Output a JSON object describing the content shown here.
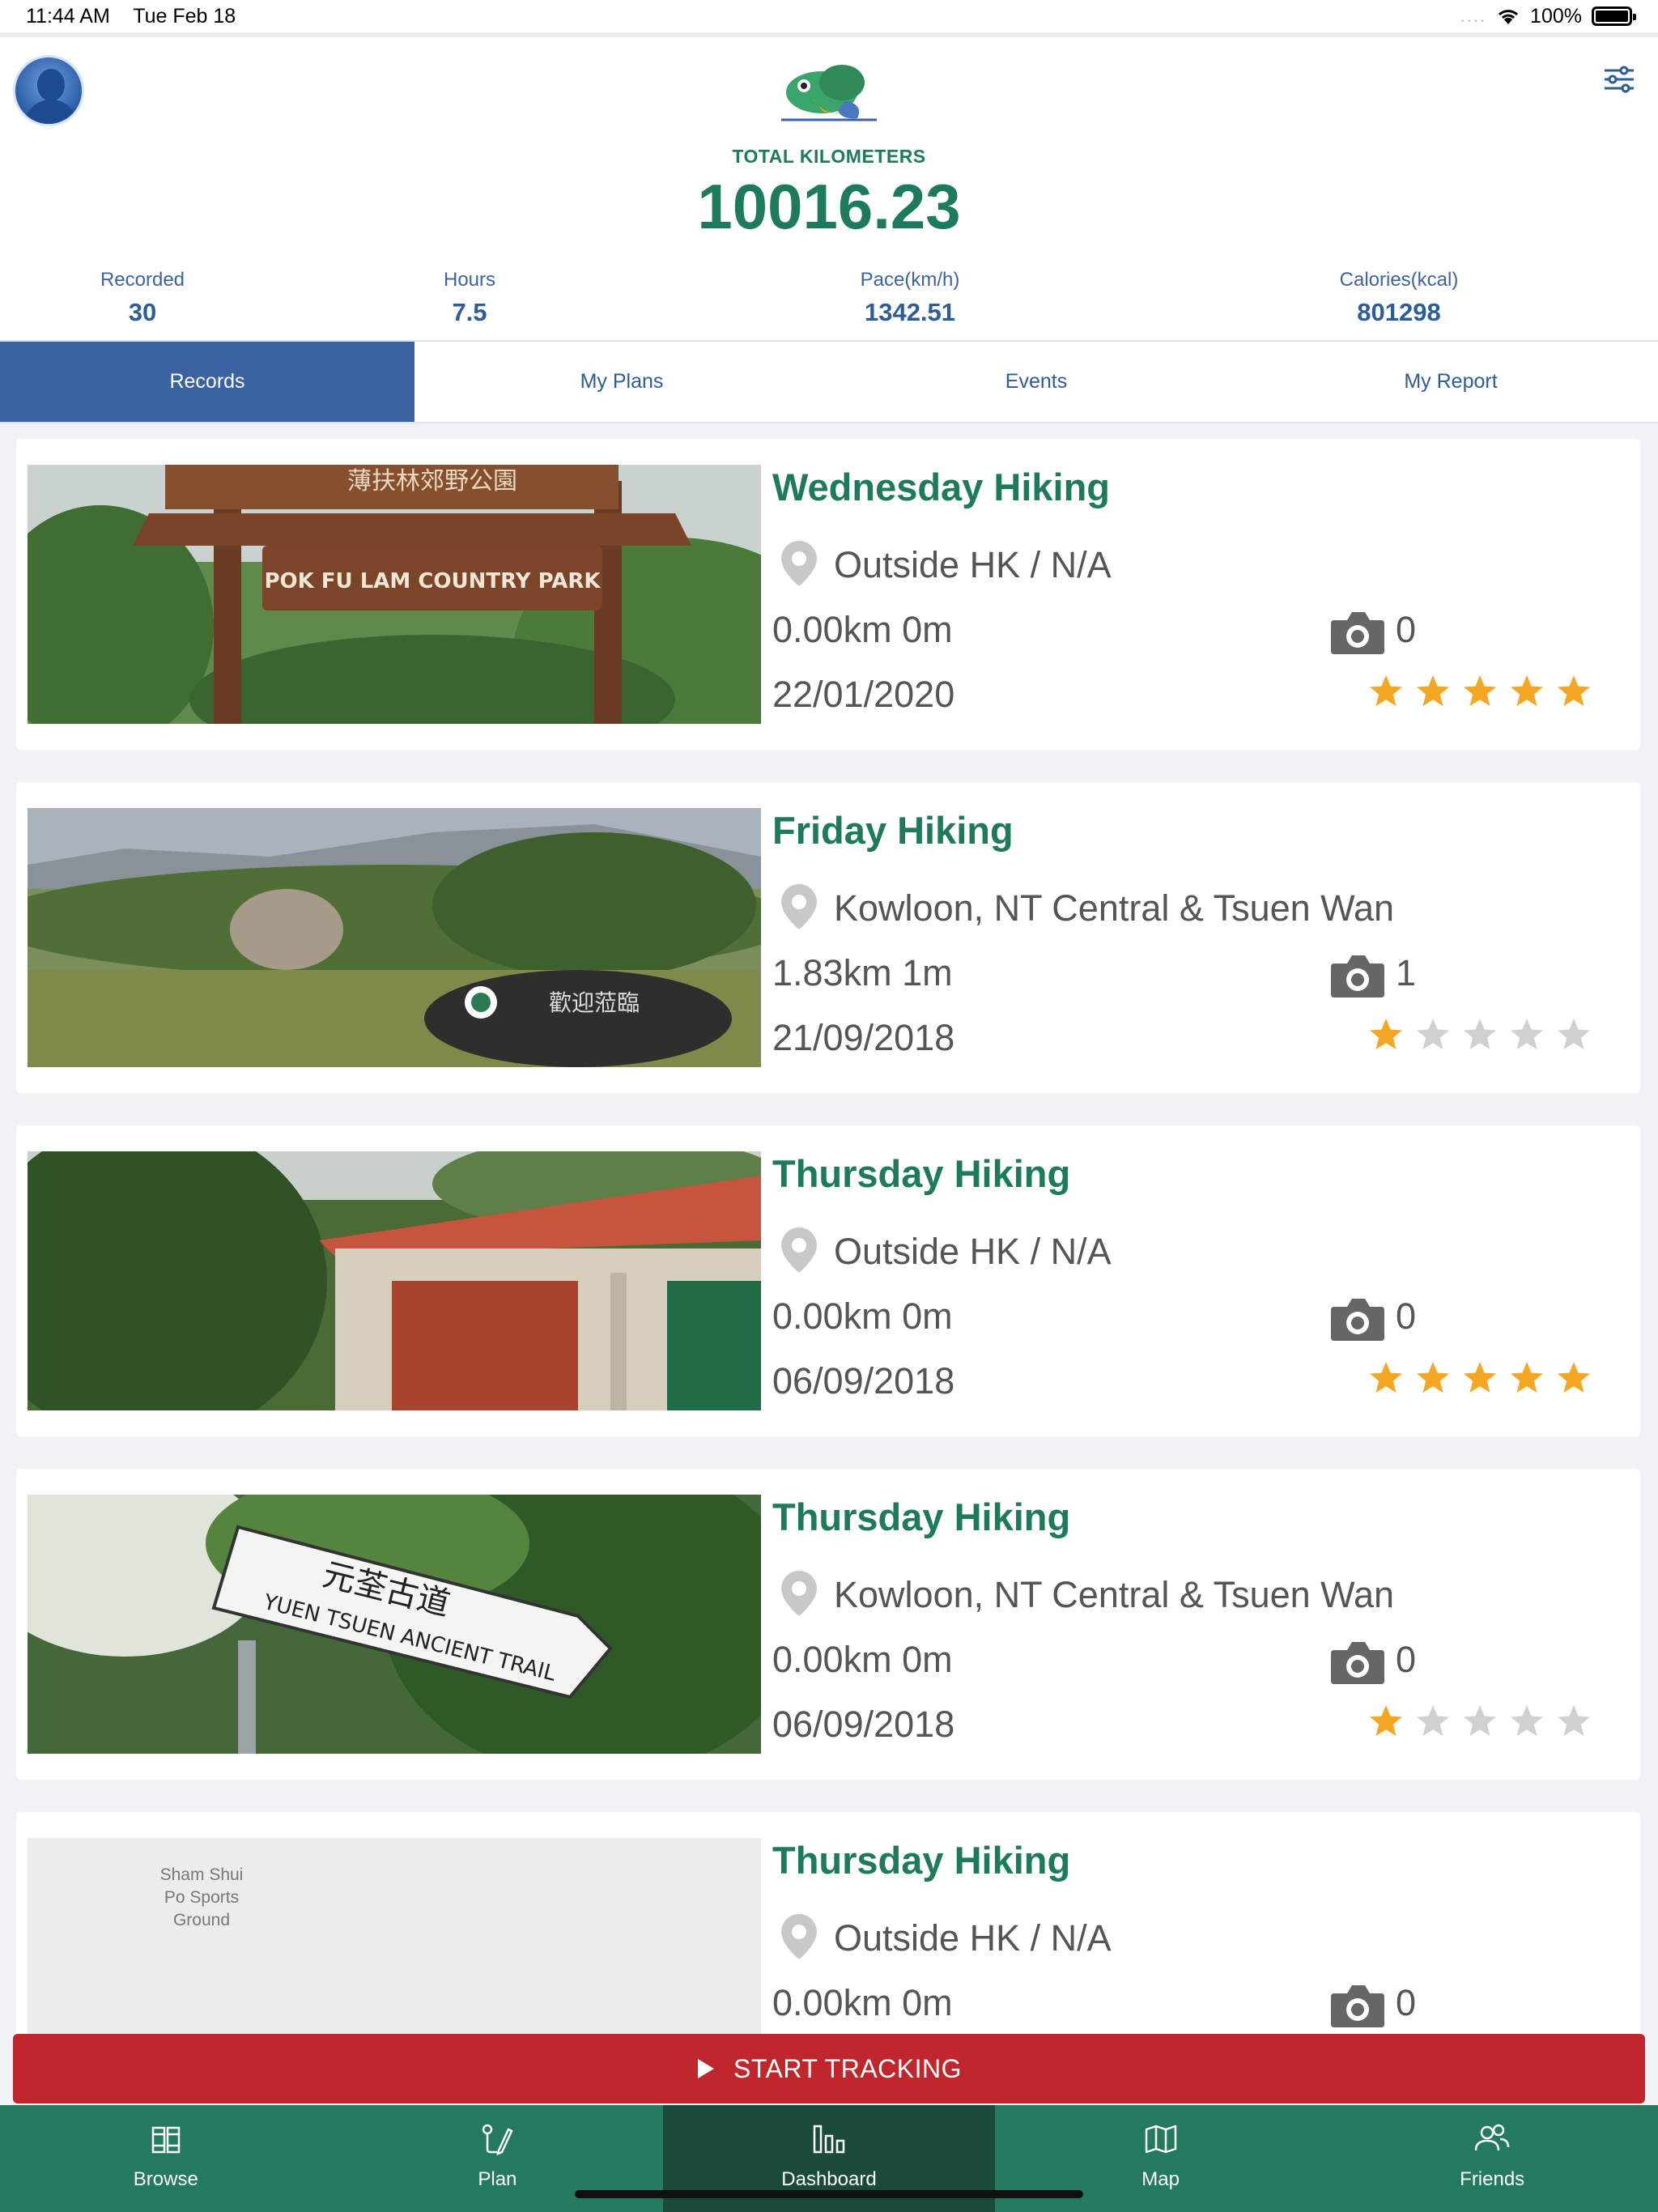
{
  "status_bar": {
    "time": "11:44 AM",
    "date": "Tue Feb 18",
    "battery": "100%"
  },
  "header": {
    "total_label": "TOTAL KILOMETERS",
    "total_value": "10016.23",
    "stats": [
      {
        "label": "Recorded",
        "value": "30"
      },
      {
        "label": "Hours",
        "value": "7.5"
      },
      {
        "label": "Pace(km/h)",
        "value": "1342.51"
      },
      {
        "label": "Calories(kcal)",
        "value": "801298"
      }
    ]
  },
  "tabs": [
    {
      "label": "Records",
      "active": true
    },
    {
      "label": "My Plans",
      "active": false
    },
    {
      "label": "Events",
      "active": false
    },
    {
      "label": "My Report",
      "active": false
    }
  ],
  "records": [
    {
      "title": "Wednesday Hiking",
      "location": "Outside HK / N/A",
      "distance": "0.00km  0m",
      "photos": "0",
      "date": "22/01/2020",
      "rating": 5,
      "image_text": "POK FU LAM COUNTRY PARK",
      "image_text_cn": "薄扶林郊野公園"
    },
    {
      "title": "Friday Hiking",
      "location": "Kowloon, NT Central & Tsuen Wan",
      "distance": "1.83km  1m",
      "photos": "1",
      "date": "21/09/2018",
      "rating": 1,
      "image_text_cn": "歡迎蒞臨"
    },
    {
      "title": "Thursday Hiking",
      "location": "Outside HK / N/A",
      "distance": "0.00km  0m",
      "photos": "0",
      "date": "06/09/2018",
      "rating": 5
    },
    {
      "title": "Thursday Hiking",
      "location": "Kowloon, NT Central & Tsuen Wan",
      "distance": "0.00km  0m",
      "photos": "0",
      "date": "06/09/2018",
      "rating": 1,
      "image_text": "YUEN TSUEN ANCIENT TRAIL",
      "image_text_cn": "元荃古道"
    },
    {
      "title": "Thursday Hiking",
      "location": "Outside HK / N/A",
      "distance": "0.00km  0m",
      "photos": "0",
      "date": "",
      "rating": 0,
      "map_label": "Sham Shui Po Sports Ground"
    }
  ],
  "start_button": {
    "label": "START TRACKING"
  },
  "bottom_nav": [
    {
      "label": "Browse",
      "icon": "book-icon",
      "active": false
    },
    {
      "label": "Plan",
      "icon": "pen-route-icon",
      "active": false
    },
    {
      "label": "Dashboard",
      "icon": "bar-chart-icon",
      "active": true
    },
    {
      "label": "Map",
      "icon": "map-icon",
      "active": false
    },
    {
      "label": "Friends",
      "icon": "friends-icon",
      "active": false
    }
  ],
  "colors": {
    "green": "#1e7a5d",
    "blue": "#3a62a0",
    "red": "#c0272d",
    "star": "#f5a623",
    "star_empty": "#d0d0d0"
  }
}
